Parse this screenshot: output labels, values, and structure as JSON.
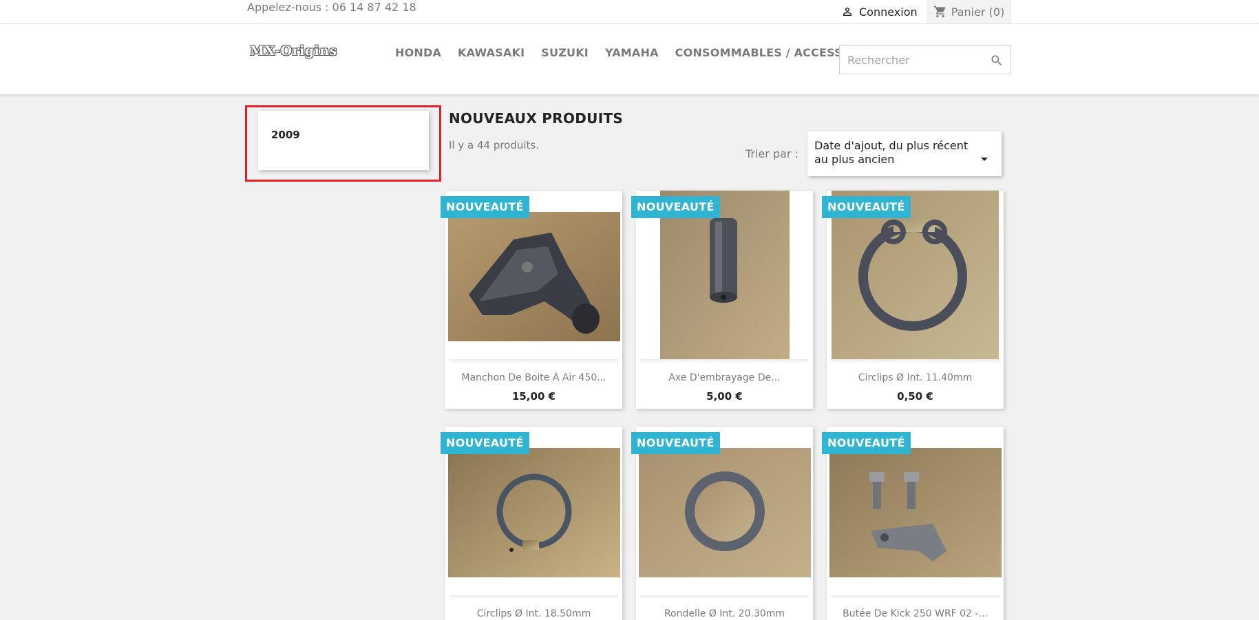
{
  "topbar": {
    "phone": "Appelez-nous : 06 14 87 42 18",
    "login": "Connexion",
    "cart": "Panier (0)"
  },
  "header": {
    "logo": "MX-Origins",
    "nav": [
      "HONDA",
      "KAWASAKI",
      "SUZUKI",
      "YAMAHA",
      "CONSOMMABLES / ACCESSOIRES"
    ],
    "search_placeholder": "Rechercher"
  },
  "sidebar": {
    "item": "2009"
  },
  "main": {
    "title": "NOUVEAUX PRODUITS",
    "count": "Il y a 44 produits.",
    "sort_label": "Trier par :",
    "sort_value": "Date d'ajout, du plus récent au plus ancien"
  },
  "products": [
    {
      "badge": "NOUVEAUTÉ",
      "name": "Manchon De Boite À Air 450...",
      "price": "15,00 €"
    },
    {
      "badge": "NOUVEAUTÉ",
      "name": "Axe D'embrayage De...",
      "price": "5,00 €"
    },
    {
      "badge": "NOUVEAUTÉ",
      "name": "Circlips Ø Int. 11.40mm",
      "price": "0,50 €"
    },
    {
      "badge": "NOUVEAUTÉ",
      "name": "Circlips Ø Int. 18.50mm",
      "price": ""
    },
    {
      "badge": "NOUVEAUTÉ",
      "name": "Rondelle Ø Int. 20.30mm",
      "price": ""
    },
    {
      "badge": "NOUVEAUTÉ",
      "name": "Butée De Kick 250 WRF 02 -...",
      "price": ""
    }
  ],
  "colors": {
    "badge": "#2fb5d2",
    "highlight": "#e2202c"
  }
}
